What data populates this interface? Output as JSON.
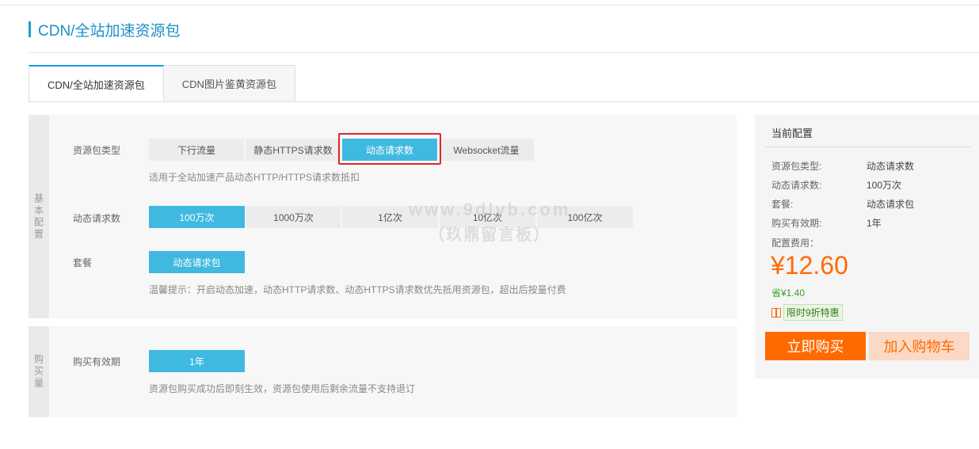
{
  "page": {
    "title": "CDN/全站加速资源包"
  },
  "tabs": [
    {
      "label": "CDN/全站加速资源包",
      "active": true
    },
    {
      "label": "CDN图片鉴黄资源包",
      "active": false
    }
  ],
  "basic": {
    "side_label": "基本配置",
    "package_type": {
      "label": "资源包类型",
      "options": [
        "下行流量",
        "静态HTTPS请求数",
        "动态请求数",
        "Websocket流量"
      ],
      "selected": "动态请求数",
      "hint": "适用于全站加速产品动态HTTP/HTTPS请求数抵扣"
    },
    "request_count": {
      "label": "动态请求数",
      "options": [
        "100万次",
        "1000万次",
        "1亿次",
        "10亿次",
        "100亿次"
      ],
      "selected": "100万次"
    },
    "plan": {
      "label": "套餐",
      "options": [
        "动态请求包"
      ],
      "selected": "动态请求包",
      "hint": "温馨提示：开启动态加速，动态HTTP请求数、动态HTTPS请求数优先抵用资源包，超出后按量付费"
    }
  },
  "purchase": {
    "side_label": "购买量",
    "validity": {
      "label": "购买有效期",
      "options": [
        "1年"
      ],
      "selected": "1年",
      "hint": "资源包购买成功后即刻生效，资源包使用后剩余流量不支持退订"
    }
  },
  "watermark": {
    "line1": "www.9dlyb.com",
    "line2": "（玖鼎留言板）"
  },
  "cart": {
    "title": "当前配置",
    "items": [
      {
        "key": "资源包类型:",
        "value": "动态请求数"
      },
      {
        "key": "动态请求数:",
        "value": "100万次"
      },
      {
        "key": "套餐:",
        "value": "动态请求包"
      },
      {
        "key": "购买有效期:",
        "value": "1年"
      }
    ],
    "fee_label": "配置费用：",
    "price": "¥12.60",
    "save": "省¥1.40",
    "promo": "限时9折特惠",
    "buy_label": "立即购买",
    "add_cart_label": "加入购物车"
  },
  "colors": {
    "accent": "#40b9e1",
    "orange": "#ff6a00",
    "highlight": "#e0262a"
  }
}
